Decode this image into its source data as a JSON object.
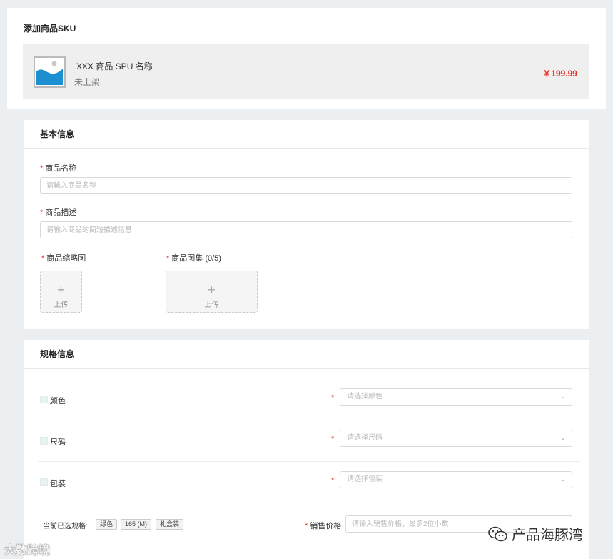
{
  "header": {
    "title": "添加商品SKU"
  },
  "spu": {
    "image_icon": "image-placeholder-icon",
    "name": "XXX 商品 SPU 名称",
    "status": "未上架",
    "price": "￥199.99"
  },
  "basic_info": {
    "title": "基本信息",
    "name_field": {
      "required": "*",
      "label": "商品名称",
      "placeholder": "请输入商品名称"
    },
    "desc_field": {
      "required": "*",
      "label": "商品描述",
      "placeholder": "请输入商品的简短描述信息"
    },
    "thumbnail": {
      "required": "*",
      "label": "商品缩略图",
      "upload_icon": "plus-icon",
      "upload_label": "上传"
    },
    "gallery": {
      "required": "*",
      "label": "商品图集 (0/5)",
      "upload_icon": "plus-icon",
      "upload_label": "上传"
    }
  },
  "spec_info": {
    "title": "规格信息",
    "rows": [
      {
        "name": "颜色",
        "required": "*",
        "placeholder": "请选择颜色",
        "checked": false
      },
      {
        "name": "尺码",
        "required": "*",
        "placeholder": "请选择尺码",
        "checked": false
      },
      {
        "name": "包装",
        "required": "*",
        "placeholder": "请选择包装",
        "checked": false
      }
    ],
    "selected_label": "当前已选规格:",
    "selected_tags": [
      "绿色",
      "165 (M)",
      "礼盒装"
    ],
    "price_field": {
      "required": "*",
      "label": "销售价格",
      "placeholder": "请输入销售价格，最多2位小数"
    }
  },
  "watermarks": {
    "left": "大数跨境",
    "right": "产品海豚湾",
    "right_icon": "wechat-icon"
  },
  "colors": {
    "price_red": "#e6332a",
    "background": "#eceff2",
    "required_red": "#e6332a"
  }
}
